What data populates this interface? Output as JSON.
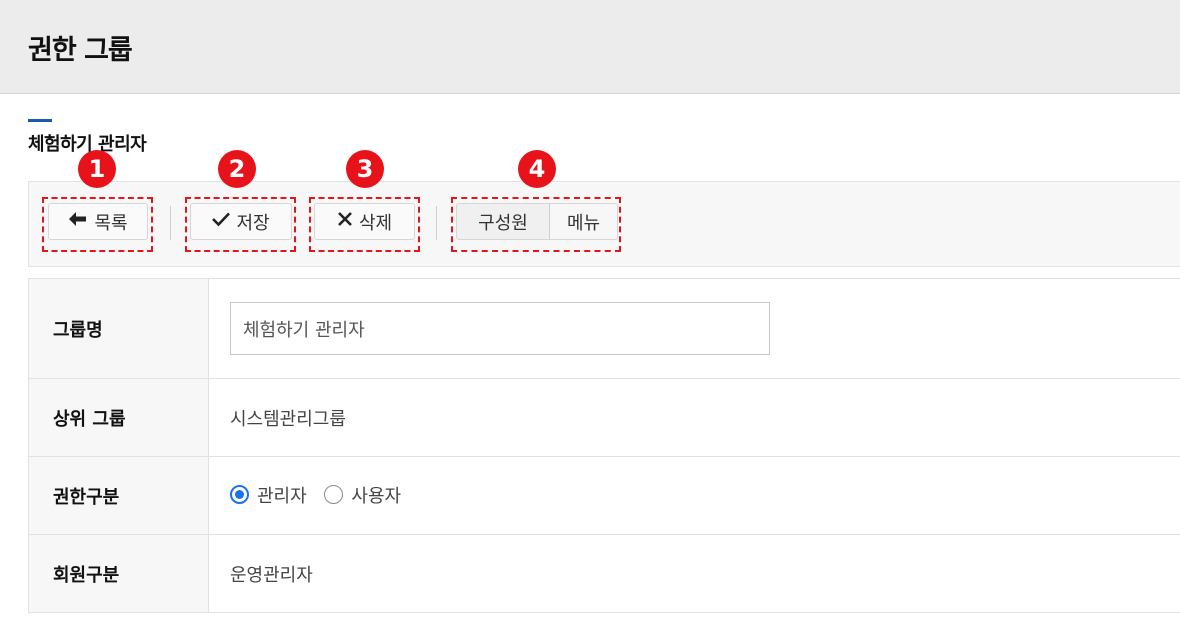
{
  "header": {
    "title": "권한 그룹"
  },
  "section": {
    "title": "체험하기 관리자"
  },
  "toolbar": {
    "list_label": "목록",
    "save_label": "저장",
    "delete_label": "삭제",
    "members_label": "구성원",
    "menu_label": "메뉴"
  },
  "callouts": [
    "1",
    "2",
    "3",
    "4"
  ],
  "form": {
    "group_name_label": "그룹명",
    "group_name_value": "체험하기 관리자",
    "parent_group_label": "상위 그룹",
    "parent_group_value": "시스템관리그룹",
    "permission_type_label": "권한구분",
    "permission_options": [
      "관리자",
      "사용자"
    ],
    "permission_selected": "관리자",
    "member_type_label": "회원구분",
    "member_type_value": "운영관리자"
  },
  "colors": {
    "callout": "#e8121a",
    "accent": "#1b5aa6",
    "radio": "#1a73e8"
  },
  "icons": {
    "list": "arrow-left-icon",
    "save": "check-icon",
    "delete": "x-icon"
  }
}
